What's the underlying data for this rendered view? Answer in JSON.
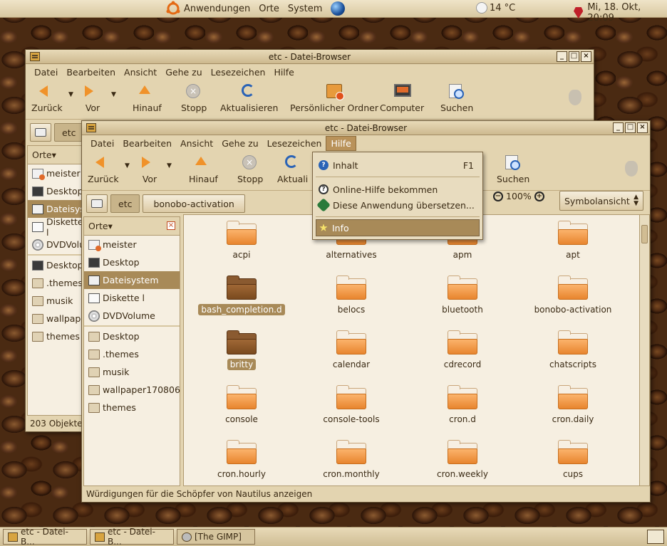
{
  "top_panel": {
    "menus": [
      "Anwendungen",
      "Orte",
      "System"
    ],
    "weather": "14 °C",
    "clock": "Mi, 18. Okt, 20:09"
  },
  "back_window": {
    "title": "etc - Datei-Browser",
    "menus": [
      "Datei",
      "Bearbeiten",
      "Ansicht",
      "Gehe zu",
      "Lesezeichen",
      "Hilfe"
    ],
    "toolbar": {
      "back": "Zurück",
      "forward": "Vor",
      "up": "Hinauf",
      "stop": "Stopp",
      "reload": "Aktualisieren",
      "home": "Persönlicher Ordner",
      "computer": "Computer",
      "search": "Suchen"
    },
    "location": "etc",
    "sidebar_header": "Orte",
    "sidebar_items": [
      "meister",
      "Desktop",
      "Dateisystem",
      "Diskette l",
      "DVDVolume",
      "Desktop",
      ".themes",
      "musik",
      "wallpaper",
      "themes"
    ],
    "status": "203 Objekte"
  },
  "front_window": {
    "title": "etc - Datei-Browser",
    "menus": [
      "Datei",
      "Bearbeiten",
      "Ansicht",
      "Gehe zu",
      "Lesezeichen",
      "Hilfe"
    ],
    "toolbar": {
      "back": "Zurück",
      "forward": "Vor",
      "up": "Hinauf",
      "stop": "Stopp",
      "reload": "Aktuali",
      "search": "Suchen"
    },
    "location": [
      "etc",
      "bonobo-activation"
    ],
    "zoom": "100%",
    "view": "Symbolansicht",
    "sidebar_header": "Orte",
    "sidebar_items": [
      "meister",
      "Desktop",
      "Dateisystem",
      "Diskette l",
      "DVDVolume",
      "Desktop",
      ".themes",
      "musik",
      "wallpaper170806",
      "themes"
    ],
    "files": [
      "acpi",
      "alternatives",
      "apm",
      "apt",
      "bash_completion.d",
      "belocs",
      "bluetooth",
      "bonobo-activation",
      "britty",
      "calendar",
      "cdrecord",
      "chatscripts",
      "console",
      "console-tools",
      "cron.d",
      "cron.daily",
      "cron.hourly",
      "cron.monthly",
      "cron.weekly",
      "cups"
    ],
    "status": "Würdigungen für die Schöpfer von Nautilus anzeigen"
  },
  "help_menu": {
    "items": [
      {
        "label": "Inhalt",
        "accel": "F1"
      },
      {
        "label": "Online-Hilfe bekommen"
      },
      {
        "label": "Diese Anwendung übersetzen..."
      },
      {
        "label": "Info"
      }
    ]
  },
  "taskbar": {
    "tasks": [
      "etc - Datei-B...",
      "etc - Datei-B...",
      "[The GIMP]"
    ]
  }
}
